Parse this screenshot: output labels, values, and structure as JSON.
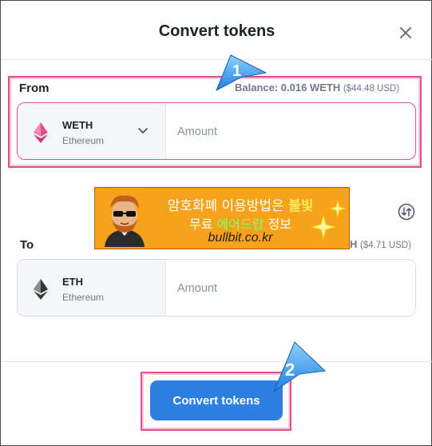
{
  "modal": {
    "title": "Convert tokens",
    "close_icon": "close-icon"
  },
  "from": {
    "label": "From",
    "balance": "Balance: 0.016 WETH",
    "balance_usd": "($44.48 USD)",
    "token_symbol": "WETH",
    "token_network": "Ethereum",
    "amount_placeholder": "Amount"
  },
  "to": {
    "label": "To",
    "balance_tail": "H",
    "balance_usd": "($4.71 USD)",
    "token_symbol": "ETH",
    "token_network": "Ethereum",
    "amount_placeholder": "Amount"
  },
  "banner": {
    "line1_a": "암호화폐 이용방법은 ",
    "line1_b": "불빛",
    "line2_a": "무료 ",
    "line2_b": "에어드랍",
    "line2_c": " 정보",
    "url": "bullbit.co.kr"
  },
  "action": {
    "button_label": "Convert tokens"
  },
  "callouts": {
    "step1": "1",
    "step2": "2"
  },
  "colors": {
    "accent": "#2d7fe2",
    "highlight": "#e0508f",
    "banner_bg": "#f7a21b"
  }
}
